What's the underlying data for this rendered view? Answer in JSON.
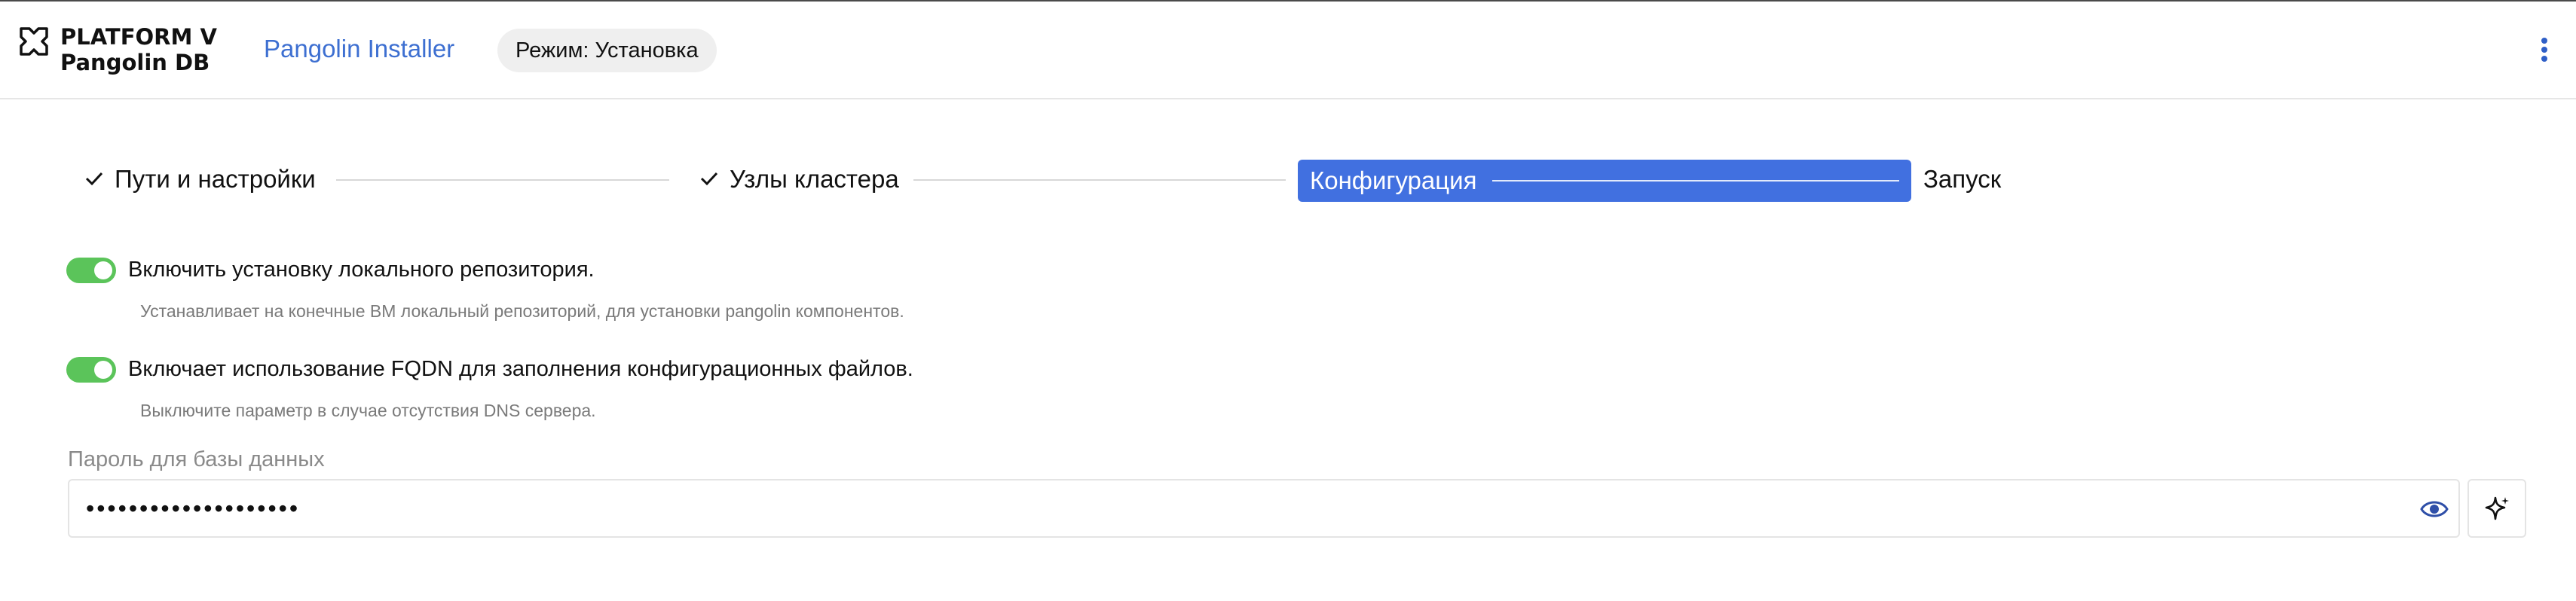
{
  "header": {
    "logo": {
      "line1": "PLATFORM V",
      "line2": "Pangolin DB"
    },
    "app_title": "Pangolin Installer",
    "mode_badge": "Режим: Установка",
    "menu_icon": "kebab-vertical-icon"
  },
  "stepper": {
    "steps": [
      {
        "label": "Пути и настройки",
        "state": "completed"
      },
      {
        "label": "Узлы кластера",
        "state": "completed"
      },
      {
        "label": "Конфигурация",
        "state": "active"
      },
      {
        "label": "Запуск",
        "state": "pending"
      }
    ],
    "active_color": "#4170E0"
  },
  "options": [
    {
      "label": "Включить установку локального репозитория.",
      "description": "Устанавливает на конечные ВМ локальный репозиторий, для установки pangolin компонентов.",
      "enabled": true
    },
    {
      "label": "Включает использование FQDN для заполнения конфигурационных файлов.",
      "description": "Выключите параметр в случае отсутствия DNS сервера.",
      "enabled": true
    }
  ],
  "password": {
    "label": "Пароль для базы данных",
    "masked_value": "••••••••••••••••••••",
    "show_icon": "eye-icon",
    "generate_icon": "sparkle-icon"
  },
  "colors": {
    "accent": "#4170E0",
    "link": "#3D6FD1",
    "toggle_on": "#5BC45A"
  }
}
